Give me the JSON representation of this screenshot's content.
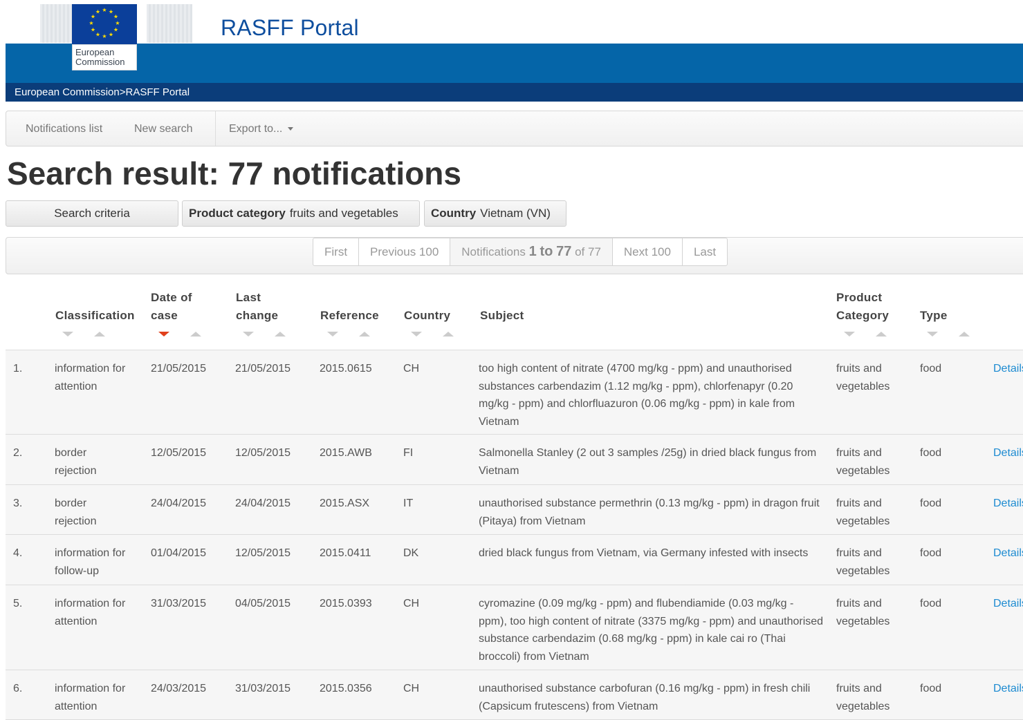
{
  "header": {
    "logo_text_line1": "European",
    "logo_text_line2": "Commission",
    "site_title": "RASFF Portal",
    "breadcrumb": [
      "European Commission",
      "RASFF Portal"
    ],
    "breadcrumb_separator": ">"
  },
  "nav": {
    "notifications_list": "Notifications list",
    "new_search": "New search",
    "export": "Export to..."
  },
  "page": {
    "title_prefix": "Search result: ",
    "count": "77",
    "title_suffix": " notifications"
  },
  "criteria": {
    "search_criteria_button": "Search criteria",
    "product_category_label": "Product category",
    "product_category_value": "fruits and vegetables",
    "country_label": "Country",
    "country_value": "Vietnam (VN)"
  },
  "pagination": {
    "first": "First",
    "previous": "Previous 100",
    "status_prefix": "Notifications",
    "range_start": "1",
    "range_to": "to",
    "range_end": "77",
    "of_total": "of 77",
    "next": "Next 100",
    "last": "Last"
  },
  "table": {
    "columns": {
      "classification": "Classification",
      "date_of_case_1": "Date of",
      "date_of_case_2": "case",
      "last_change_1": "Last",
      "last_change_2": "change",
      "reference": "Reference",
      "country": "Country",
      "subject": "Subject",
      "product_category_1": "Product",
      "product_category_2": "Category",
      "type": "Type"
    },
    "active_sort": "Date of case (descending)",
    "rows": [
      {
        "num": "1.",
        "classification": "information for attention",
        "date_of_case": "21/05/2015",
        "last_change": "21/05/2015",
        "reference": "2015.0615",
        "country": "CH",
        "subject": "too high content of nitrate (4700 mg/kg - ppm) and unauthorised substances carbendazim (1.12 mg/kg - ppm), chlorfenapyr (0.20 mg/kg - ppm) and chlorfluazuron (0.06 mg/kg - ppm) in kale from Vietnam",
        "category": "fruits and vegetables",
        "type": "food",
        "details": "Details"
      },
      {
        "num": "2.",
        "classification": "border rejection",
        "date_of_case": "12/05/2015",
        "last_change": "12/05/2015",
        "reference": "2015.AWB",
        "country": "FI",
        "subject": "Salmonella Stanley (2 out 3 samples /25g) in dried black fungus from Vietnam",
        "category": "fruits and vegetables",
        "type": "food",
        "details": "Details"
      },
      {
        "num": "3.",
        "classification": "border rejection",
        "date_of_case": "24/04/2015",
        "last_change": "24/04/2015",
        "reference": "2015.ASX",
        "country": "IT",
        "subject": "unauthorised substance permethrin (0.13 mg/kg - ppm) in dragon fruit (Pitaya) from Vietnam",
        "category": "fruits and vegetables",
        "type": "food",
        "details": "Details"
      },
      {
        "num": "4.",
        "classification": "information for follow-up",
        "date_of_case": "01/04/2015",
        "last_change": "12/05/2015",
        "reference": "2015.0411",
        "country": "DK",
        "subject": "dried black fungus from Vietnam, via Germany infested with insects",
        "category": "fruits and vegetables",
        "type": "food",
        "details": "Details"
      },
      {
        "num": "5.",
        "classification": "information for attention",
        "date_of_case": "31/03/2015",
        "last_change": "04/05/2015",
        "reference": "2015.0393",
        "country": "CH",
        "subject": "cyromazine (0.09 mg/kg - ppm) and flubendiamide (0.03 mg/kg - ppm), too high content of nitrate (3375 mg/kg - ppm) and unauthorised substance carbendazim (0.68 mg/kg - ppm) in kale cai ro (Thai broccoli) from Vietnam",
        "category": "fruits and vegetables",
        "type": "food",
        "details": "Details"
      },
      {
        "num": "6.",
        "classification": "information for attention",
        "date_of_case": "24/03/2015",
        "last_change": "31/03/2015",
        "reference": "2015.0356",
        "country": "CH",
        "subject": "unauthorised substance carbofuran (0.16 mg/kg - ppm) in fresh chili (Capsicum frutescens) from Vietnam",
        "category": "fruits and vegetables",
        "type": "food",
        "details": "Details"
      }
    ]
  },
  "colors": {
    "brand_blue": "#0565a8",
    "breadcrumb_bar": "#0b3d7a",
    "title_blue": "#0e4e9e",
    "link_blue": "#1d8bd1",
    "active_sort_red": "#e0401c"
  }
}
